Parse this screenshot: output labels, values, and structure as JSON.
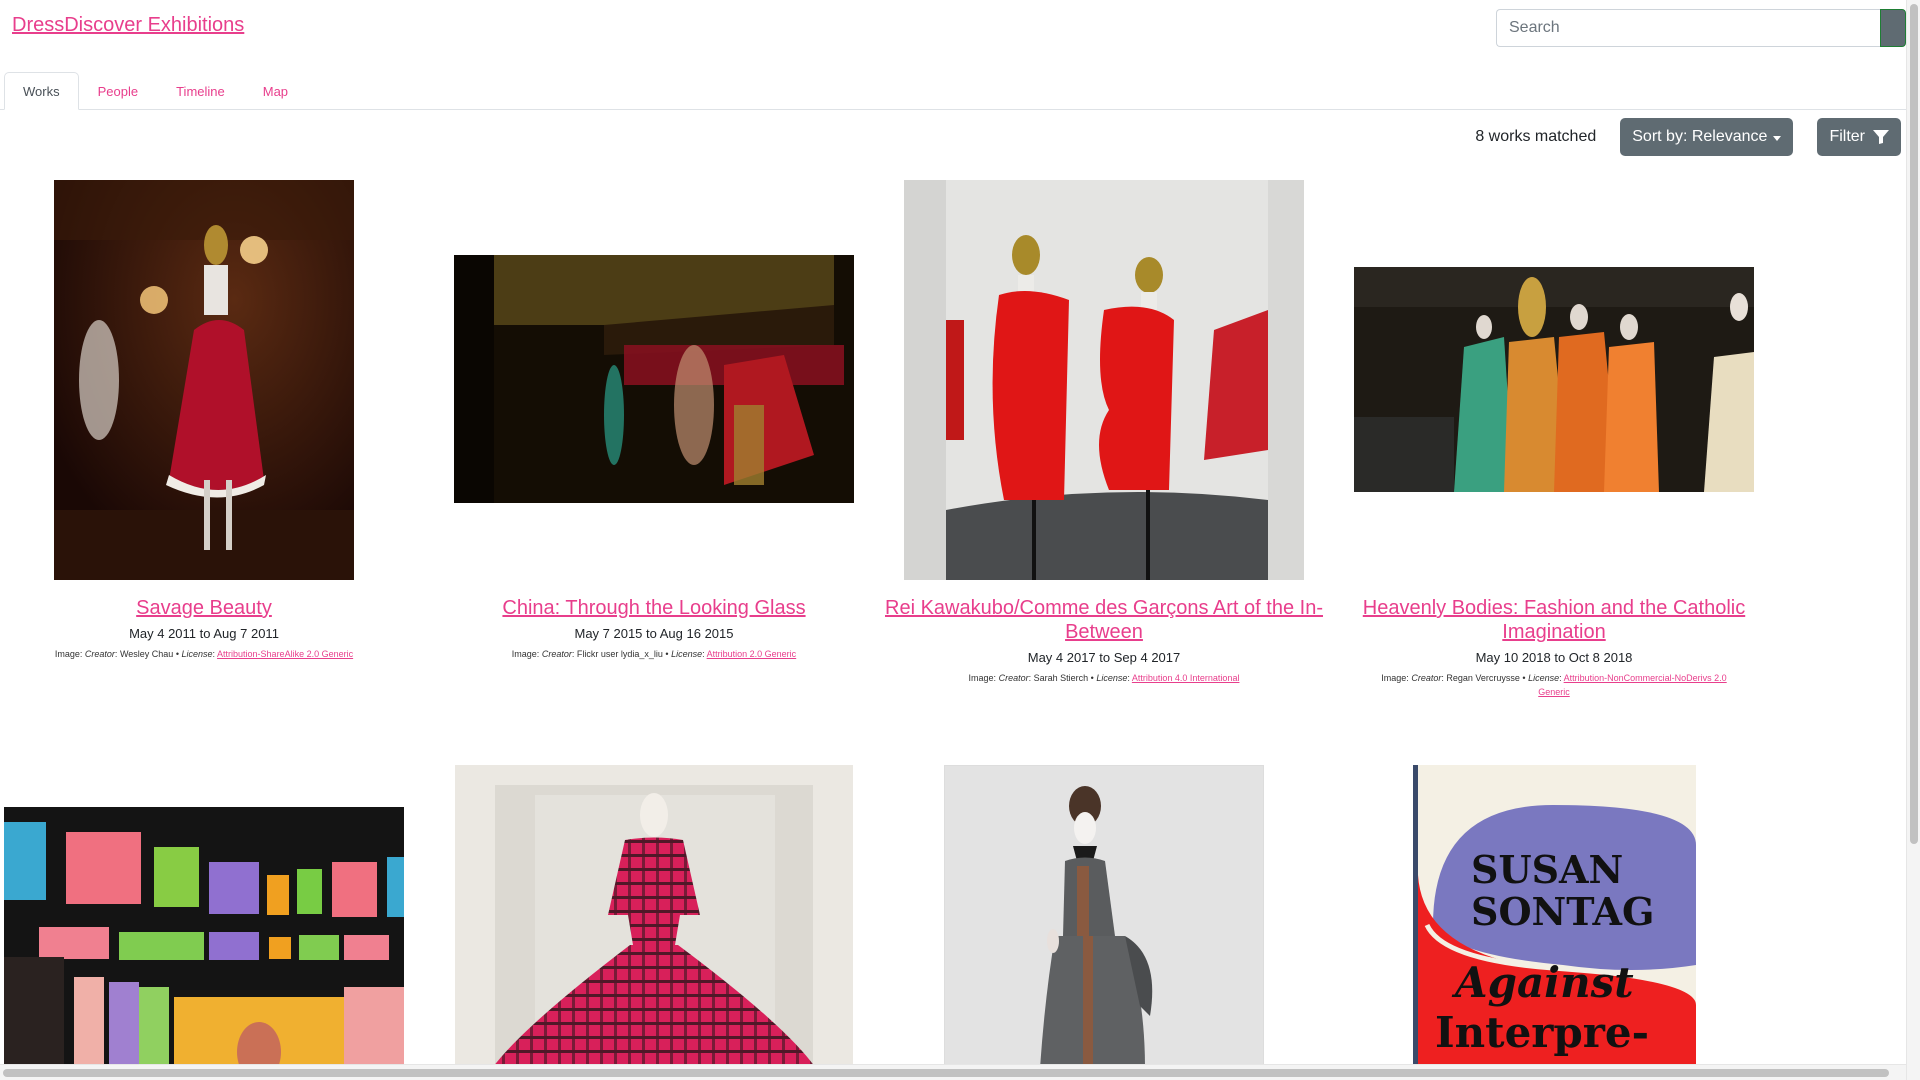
{
  "header": {
    "site_title": "DressDiscover Exhibitions",
    "search_placeholder": "Search"
  },
  "tabs": [
    {
      "label": "Works",
      "active": true
    },
    {
      "label": "People",
      "active": false
    },
    {
      "label": "Timeline",
      "active": false
    },
    {
      "label": "Map",
      "active": false
    }
  ],
  "toolbar": {
    "match_count": "8 works matched",
    "sort_label": "Sort by: Relevance",
    "filter_label": "Filter"
  },
  "credit_labels": {
    "image": "Image:",
    "creator": "Creator",
    "license": "License",
    "separator": "•"
  },
  "works": [
    {
      "title": "Savage Beauty",
      "dates": "May 4 2011 to Aug 7 2011",
      "creator": "Wesley Chau",
      "license": "Attribution-ShareAlike 2.0 Generic",
      "image_desc": "red feathered dress on mannequin in dark wood-paneled gallery"
    },
    {
      "title": "China: Through the Looking Glass",
      "dates": "May 7 2015 to Aug 16 2015",
      "creator": "Flickr user lydia_x_liu",
      "license": "Attribution 2.0 Generic",
      "image_desc": "dim gallery with Chinese pavilion and embroidered robes"
    },
    {
      "title": "Rei Kawakubo/Comme des Garçons Art of the In-Between",
      "dates": "May 4 2017 to Sep 4 2017",
      "creator": "Sarah Stierch",
      "license": "Attribution 4.0 International",
      "image_desc": "red sculptural garments on stands against white wall"
    },
    {
      "title": "Heavenly Bodies: Fashion and the Catholic Imagination",
      "dates": "May 10 2018 to Oct 8 2018",
      "creator": "Regan Vercruysse",
      "license": "Attribution-NonCommercial-NoDerivs 2.0 Generic",
      "image_desc": "row of mannequins in colorful gowns with gold headpieces"
    },
    {
      "title": "",
      "image_desc": "gallery with brightly lit colored display boxes"
    },
    {
      "title": "",
      "image_desc": "pink plaid ball gown in glass case"
    },
    {
      "title": "",
      "image_desc": "grey bustle dress with brown trim on mannequin"
    },
    {
      "title": "",
      "image_desc": "book cover: Susan Sontag Against Interpretation",
      "cover_text": {
        "author_line1": "SUSAN",
        "author_line2": "SONTAG",
        "title_line1": "Against",
        "title_line2": "Interpre-"
      }
    }
  ]
}
